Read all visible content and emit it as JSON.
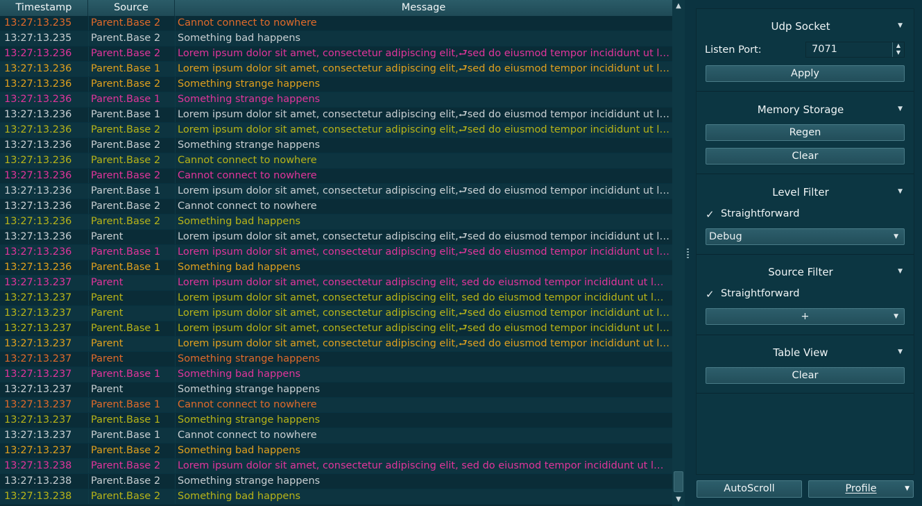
{
  "colors": {
    "red": "#e06a2a",
    "gray": "#c8cfd2",
    "magenta": "#e0359a",
    "olive": "#b8b418",
    "gold": "#e0a01e"
  },
  "log": {
    "columns": [
      "Timestamp",
      "Source",
      "Message"
    ],
    "rows": [
      {
        "ts": "13:27:13.235",
        "src": "Parent.Base 2",
        "msg": "Cannot connect to nowhere",
        "color": "red"
      },
      {
        "ts": "13:27:13.235",
        "src": "Parent.Base 2",
        "msg": "Something bad happens",
        "color": "gray"
      },
      {
        "ts": "13:27:13.236",
        "src": "Parent.Base 2",
        "msg": "Lorem ipsum dolor sit amet, consectetur adipiscing elit,⮐sed do eiusmod tempor incididunt ut labore et dolore magna aliqua.",
        "color": "magenta"
      },
      {
        "ts": "13:27:13.236",
        "src": "Parent.Base 1",
        "msg": "Lorem ipsum dolor sit amet, consectetur adipiscing elit,⮐sed do eiusmod tempor incididunt ut labore et dolore magna aliqua.",
        "color": "gold"
      },
      {
        "ts": "13:27:13.236",
        "src": "Parent.Base 2",
        "msg": "Something strange happens",
        "color": "gold"
      },
      {
        "ts": "13:27:13.236",
        "src": "Parent.Base 1",
        "msg": "Something strange happens",
        "color": "magenta"
      },
      {
        "ts": "13:27:13.236",
        "src": "Parent.Base 1",
        "msg": "Lorem ipsum dolor sit amet, consectetur adipiscing elit,⮐sed do eiusmod tempor incididunt ut labore et dolore magna aliqua.",
        "color": "gray"
      },
      {
        "ts": "13:27:13.236",
        "src": "Parent.Base 2",
        "msg": "Lorem ipsum dolor sit amet, consectetur adipiscing elit,⮐sed do eiusmod tempor incididunt ut labore et dolore magna aliqua.",
        "color": "olive"
      },
      {
        "ts": "13:27:13.236",
        "src": "Parent.Base 2",
        "msg": "Something strange happens",
        "color": "gray"
      },
      {
        "ts": "13:27:13.236",
        "src": "Parent.Base 2",
        "msg": "Cannot connect to nowhere",
        "color": "olive"
      },
      {
        "ts": "13:27:13.236",
        "src": "Parent.Base 2",
        "msg": "Cannot connect to nowhere",
        "color": "magenta"
      },
      {
        "ts": "13:27:13.236",
        "src": "Parent.Base 1",
        "msg": "Lorem ipsum dolor sit amet, consectetur adipiscing elit,⮐sed do eiusmod tempor incididunt ut labore et dolore magna aliqua.",
        "color": "gray"
      },
      {
        "ts": "13:27:13.236",
        "src": "Parent.Base 2",
        "msg": "Cannot connect to nowhere",
        "color": "gray"
      },
      {
        "ts": "13:27:13.236",
        "src": "Parent.Base 2",
        "msg": "Something bad happens",
        "color": "olive"
      },
      {
        "ts": "13:27:13.236",
        "src": "Parent",
        "msg": "Lorem ipsum dolor sit amet, consectetur adipiscing elit,⮐sed do eiusmod tempor incididunt ut labore et dolore magna aliqua.",
        "color": "gray"
      },
      {
        "ts": "13:27:13.236",
        "src": "Parent.Base 1",
        "msg": "Lorem ipsum dolor sit amet, consectetur adipiscing elit,⮐sed do eiusmod tempor incididunt ut labore et dolore magna aliqua.",
        "color": "magenta"
      },
      {
        "ts": "13:27:13.236",
        "src": "Parent.Base 1",
        "msg": "Something bad happens",
        "color": "gold"
      },
      {
        "ts": "13:27:13.237",
        "src": "Parent",
        "msg": "Lorem ipsum dolor sit amet, consectetur adipiscing elit, sed do eiusmod tempor incididunt ut labore et dolore magna aliqua.",
        "color": "magenta"
      },
      {
        "ts": "13:27:13.237",
        "src": "Parent",
        "msg": "Lorem ipsum dolor sit amet, consectetur adipiscing elit, sed do eiusmod tempor incididunt ut labore et dolore magna aliqua.",
        "color": "olive"
      },
      {
        "ts": "13:27:13.237",
        "src": "Parent",
        "msg": "Lorem ipsum dolor sit amet, consectetur adipiscing elit,⮐sed do eiusmod tempor incididunt ut labore et dolore magna aliqua.",
        "color": "olive"
      },
      {
        "ts": "13:27:13.237",
        "src": "Parent.Base 1",
        "msg": "Lorem ipsum dolor sit amet, consectetur adipiscing elit,⮐sed do eiusmod tempor incididunt ut labore et dolore magna aliqua.",
        "color": "olive"
      },
      {
        "ts": "13:27:13.237",
        "src": "Parent",
        "msg": "Lorem ipsum dolor sit amet, consectetur adipiscing elit,⮐sed do eiusmod tempor incididunt ut labore et dolore magna aliqua.",
        "color": "gold"
      },
      {
        "ts": "13:27:13.237",
        "src": "Parent",
        "msg": "Something strange happens",
        "color": "red"
      },
      {
        "ts": "13:27:13.237",
        "src": "Parent.Base 1",
        "msg": "Something bad happens",
        "color": "magenta"
      },
      {
        "ts": "13:27:13.237",
        "src": "Parent",
        "msg": "Something strange happens",
        "color": "gray"
      },
      {
        "ts": "13:27:13.237",
        "src": "Parent.Base 1",
        "msg": "Cannot connect to nowhere",
        "color": "red"
      },
      {
        "ts": "13:27:13.237",
        "src": "Parent.Base 1",
        "msg": "Something strange happens",
        "color": "olive"
      },
      {
        "ts": "13:27:13.237",
        "src": "Parent.Base 1",
        "msg": "Cannot connect to nowhere",
        "color": "gray"
      },
      {
        "ts": "13:27:13.237",
        "src": "Parent.Base 2",
        "msg": "Something bad happens",
        "color": "gold"
      },
      {
        "ts": "13:27:13.238",
        "src": "Parent.Base 2",
        "msg": "Lorem ipsum dolor sit amet, consectetur adipiscing elit, sed do eiusmod tempor incididunt ut labore et dolore magna aliqua.",
        "color": "magenta"
      },
      {
        "ts": "13:27:13.238",
        "src": "Parent.Base 2",
        "msg": "Something strange happens",
        "color": "gray"
      },
      {
        "ts": "13:27:13.238",
        "src": "Parent.Base 2",
        "msg": "Something bad happens",
        "color": "olive"
      }
    ]
  },
  "udp": {
    "title": "Udp Socket",
    "port_label": "Listen Port:",
    "port_value": "7071",
    "apply_label": "Apply"
  },
  "memory": {
    "title": "Memory Storage",
    "regen_label": "Regen",
    "clear_label": "Clear"
  },
  "level_filter": {
    "title": "Level Filter",
    "checkbox_label": "Straightforward",
    "checked": true,
    "selected": "Debug"
  },
  "source_filter": {
    "title": "Source Filter",
    "checkbox_label": "Straightforward",
    "checked": true,
    "combo_value": "+"
  },
  "table_view": {
    "title": "Table View",
    "clear_label": "Clear"
  },
  "bottom": {
    "autoscroll_label": "AutoScroll",
    "profile_label": "Profile"
  },
  "glyphs": {
    "check": "✓",
    "down": "▼",
    "up": "▲"
  }
}
